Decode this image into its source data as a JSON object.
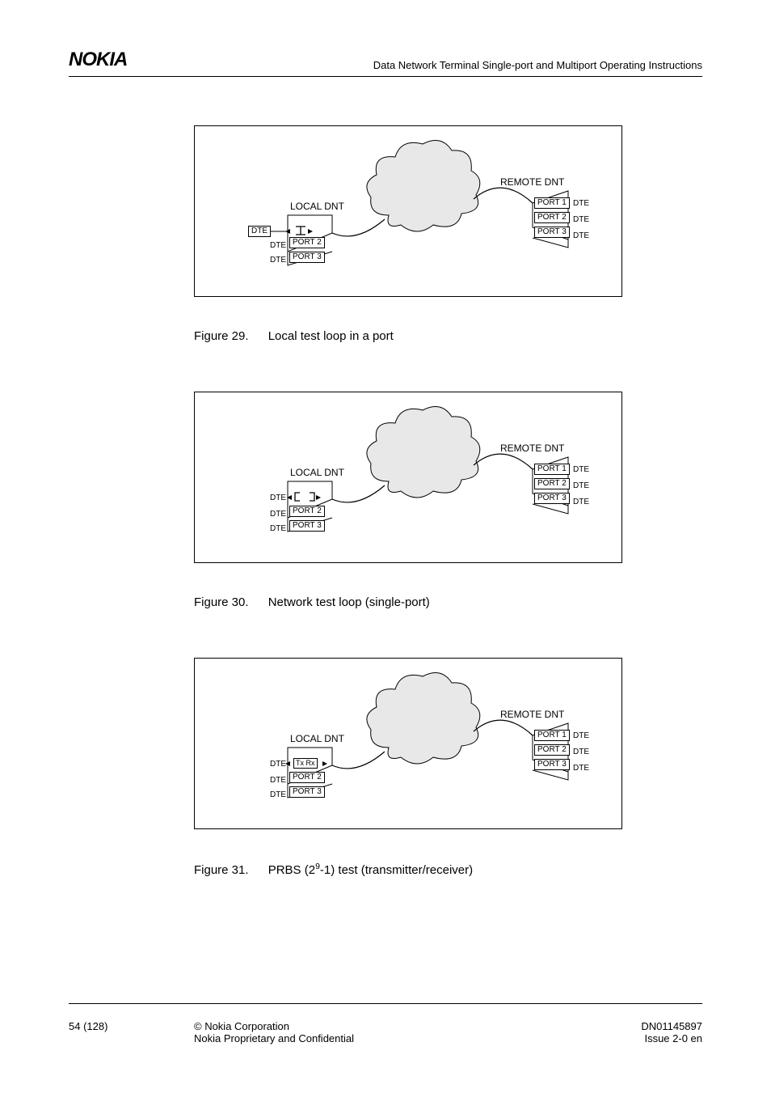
{
  "header": {
    "brand": "NOKIA",
    "title": "Data Network Terminal Single-port and Multiport Operating Instructions"
  },
  "diagram_common": {
    "local_label": "LOCAL DNT",
    "remote_label": "REMOTE DNT",
    "port1": "PORT 1",
    "port2": "PORT 2",
    "port3": "PORT 3",
    "dte": "DTE",
    "txrx": "Tx Rx"
  },
  "figures": {
    "f29": {
      "num": "Figure 29.",
      "caption": "Local test loop in a port"
    },
    "f30": {
      "num": "Figure 30.",
      "caption": "Network test loop (single-port)"
    },
    "f31": {
      "num": "Figure 31.",
      "caption_pre": "PRBS (2",
      "caption_sup": "9",
      "caption_post": "-1) test (transmitter/receiver)"
    }
  },
  "footer": {
    "page": "54 (128)",
    "copyright": "© Nokia Corporation",
    "confidential": "Nokia Proprietary and Confidential",
    "docnum": "DN01145897",
    "issue": "Issue 2-0 en"
  }
}
